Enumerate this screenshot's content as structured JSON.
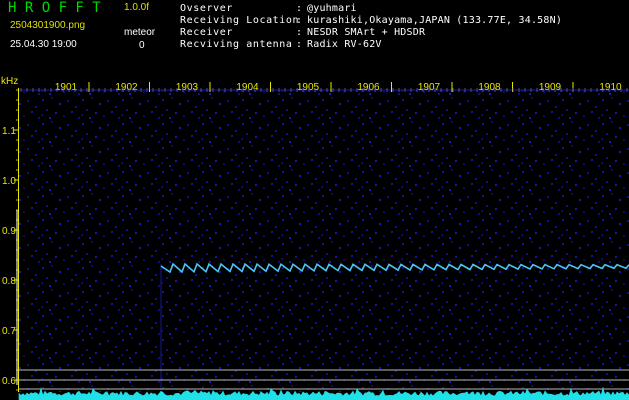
{
  "header": {
    "app_title": "H R O F F T",
    "app_version": "1.0.0f",
    "file_name": "2504301900.png",
    "date_time": "25.04.30 19:00",
    "count_label": "meteor",
    "count_value": "0"
  },
  "station": [
    {
      "label": "Ovserver",
      "value": "@yuhmari"
    },
    {
      "label": "Receiving Location",
      "value": "kurashiki,Okayama,JAPAN (133.77E, 34.58N)"
    },
    {
      "label": "Receiver",
      "value": "NESDR SMArt + HDSDR"
    },
    {
      "label": "Recviving antenna",
      "value": "Radix RV-62V"
    }
  ],
  "separator": ":",
  "axes": {
    "y_unit": "kHz",
    "y_ticks": [
      "1.1",
      "1.0",
      "0.9",
      "0.8",
      "0.7",
      "0.6"
    ],
    "x_ticks": [
      "1901",
      "1902",
      "1903",
      "1904",
      "1905",
      "1906",
      "1907",
      "1908",
      "1909",
      "1910"
    ]
  },
  "colors": {
    "background": "#000000",
    "title_green": "#00d800",
    "version_yellow": "#e0e000",
    "label_white": "#ffffff",
    "axis_yellow": "#e8e800",
    "noise_blue": "#1010a0",
    "trace_cyan": "#50d0ff",
    "guide_line": "#b8b8b8",
    "baseline_cyan": "#20e0e8"
  }
}
